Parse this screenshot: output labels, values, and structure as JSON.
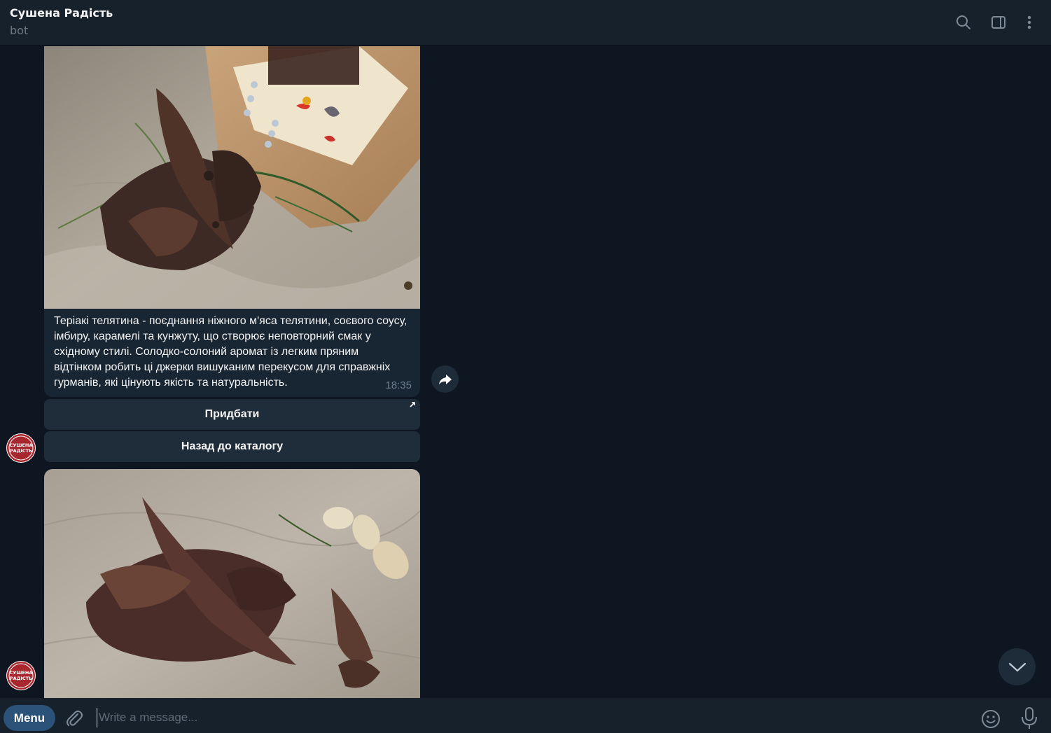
{
  "header": {
    "title": "Сушена Радість",
    "subtitle": "bot",
    "icons": [
      "search-icon",
      "sidebar-toggle-icon",
      "more-vertical-icon"
    ]
  },
  "messages": [
    {
      "type": "photo",
      "image": "Jerky with thyme, rosemary and allspice in front of a kraft paper bag with label"
    },
    {
      "type": "caption",
      "text": "Теріакі телятина - поєднання ніжного м'яса телятини, соєвого соусу, імбиру, карамелі та кунжуту, що створює неповторний смак у східному стилі. Солодко-солоний аромат із легким пряним відтінком робить ці джерки вишуканим перекусом для справжніх гурманів, які цінують якість та натуральність.",
      "time": "18:35"
    },
    {
      "type": "photo",
      "image": "Pile of dried beef jerky with garlic cloves and rosemary on crumpled paper"
    }
  ],
  "keyboard": {
    "buy_label": "Придбати",
    "back_label": "Назад до каталогу"
  },
  "avatar": {
    "brand_line1": "СУШЕНА",
    "brand_line2": "РАДІСТЬ"
  },
  "input": {
    "menu_label": "Menu",
    "placeholder": "Write a message..."
  },
  "colors": {
    "background": "#0e1621",
    "header": "#17212b",
    "bubble": "#182533",
    "button": "#1f2c3a",
    "menu_button": "#2b5278",
    "brand_red": "#a8262e"
  }
}
